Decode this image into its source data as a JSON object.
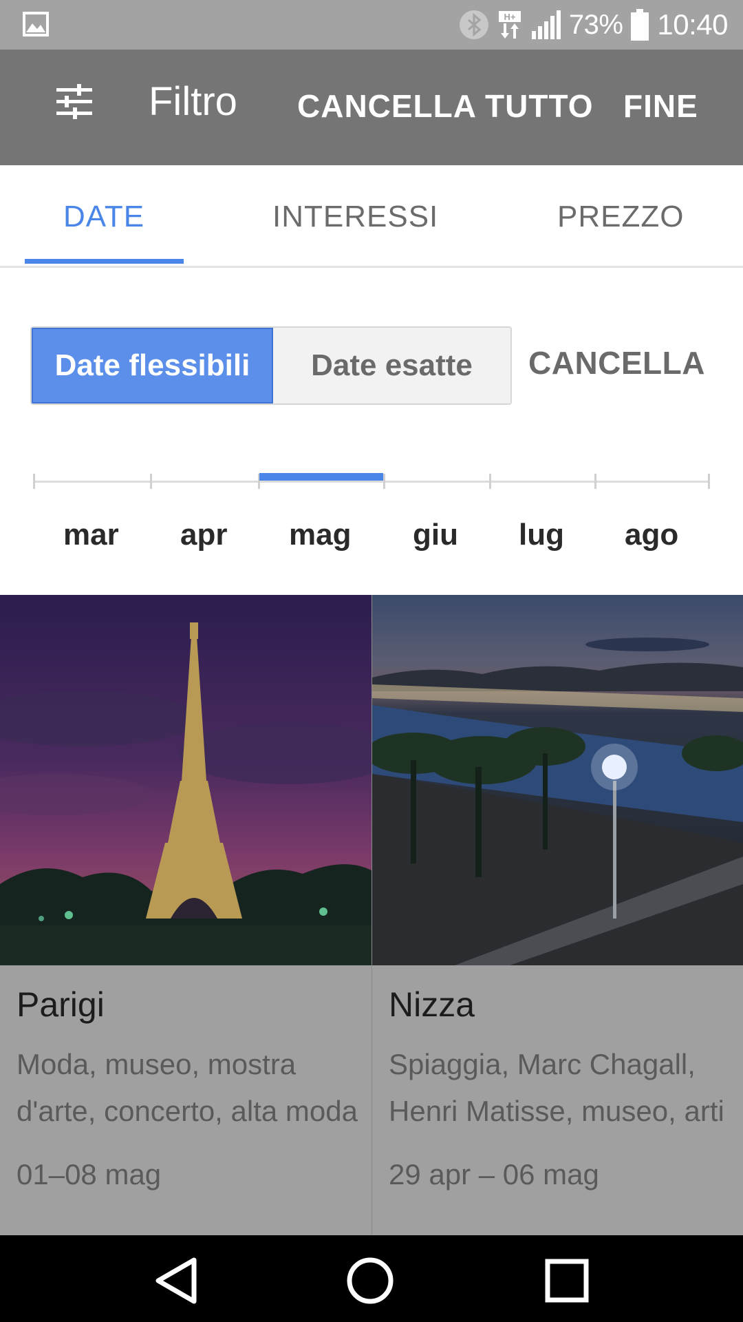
{
  "status_bar": {
    "battery": "73%",
    "time": "10:40",
    "icons": [
      "gallery-icon",
      "bluetooth-icon",
      "data-hplus-icon",
      "signal-icon",
      "battery-icon"
    ]
  },
  "app_bar": {
    "title": "Filtro",
    "clear_all": "CANCELLA TUTTO",
    "done": "FINE"
  },
  "tabs": [
    {
      "label": "DATE",
      "active": true
    },
    {
      "label": "INTERESSI",
      "active": false
    },
    {
      "label": "PREZZO",
      "active": false
    }
  ],
  "date_mode": {
    "flexible": "Date flessibili",
    "exact": "Date esatte",
    "selected": "Date flessibili",
    "cancel": "CANCELLA"
  },
  "months": [
    "mar",
    "apr",
    "mag",
    "giu",
    "lug",
    "ago"
  ],
  "selected_month": "mag",
  "cards": [
    {
      "name": "Parigi",
      "description": "Moda, museo, mostra d'arte, concerto, alta moda",
      "dates": "01–08 mag"
    },
    {
      "name": "Nizza",
      "description": "Spiaggia, Marc Chagall, Henri Matisse, museo, arti",
      "dates": "29 apr – 06 mag"
    }
  ],
  "colors": {
    "accent": "#4a86e8",
    "app_bar": "#757575",
    "status_bar": "#a3a3a3"
  }
}
